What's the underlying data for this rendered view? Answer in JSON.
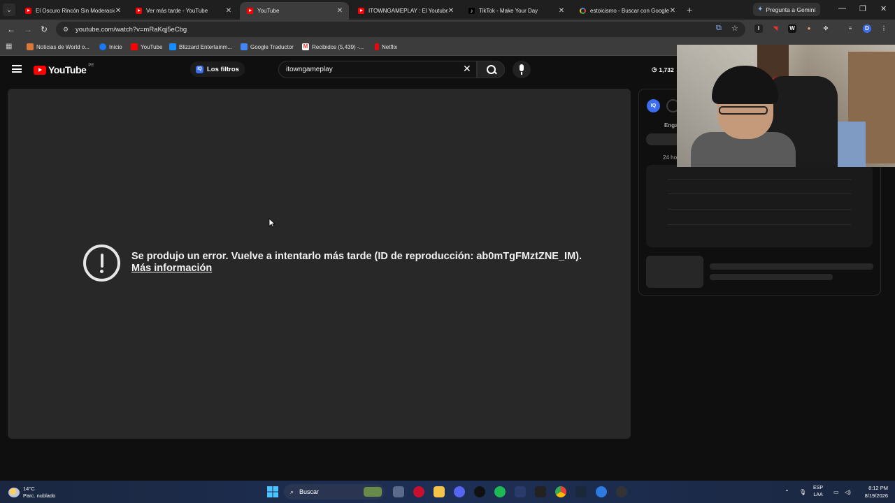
{
  "browser": {
    "tabs": [
      {
        "title": "El Oscuro Rincón Sin Moderación",
        "favicon": "youtube-icon",
        "active": false
      },
      {
        "title": "Ver más tarde - YouTube",
        "favicon": "youtube-icon",
        "active": false
      },
      {
        "title": "YouTube",
        "favicon": "youtube-icon",
        "active": true
      },
      {
        "title": "ITOWNGAMEPLAY : El Youtuber",
        "favicon": "youtube-icon",
        "active": false
      },
      {
        "title": "TikTok - Make Your Day",
        "favicon": "tiktok-icon",
        "active": false
      },
      {
        "title": "estoicismo - Buscar con Google",
        "favicon": "google-icon",
        "active": false
      }
    ],
    "gemini_label": "Pregunta a Gemini",
    "url": "youtube.com/watch?v=mRaKqj5eCbg",
    "bookmarks": [
      {
        "label": "Noticias de World o...",
        "icon": "news-icon"
      },
      {
        "label": "Inicio",
        "icon": "facebook-icon"
      },
      {
        "label": "YouTube",
        "icon": "youtube-icon"
      },
      {
        "label": "Blizzard Entertainm...",
        "icon": "blizzard-icon"
      },
      {
        "label": "Google Traductor",
        "icon": "translate-icon"
      },
      {
        "label": "Recibidos (5,439) -...",
        "icon": "gmail-icon"
      },
      {
        "label": "Netflix",
        "icon": "netflix-icon"
      }
    ]
  },
  "youtube": {
    "logo_text": "YouTube",
    "region": "PE",
    "filters_label": "Los filtros",
    "search_value": "itowngameplay",
    "counter": "1,732",
    "error_message": "Se produjo un error. Vuelve a intentarlo más tarde (ID de reproducción: ab0mTgFMztZNE_IM).",
    "error_link": "Más información",
    "side": {
      "iq_badge": "IQ",
      "label": "Enga",
      "time_label": "24 ho"
    }
  },
  "taskbar": {
    "temperature": "14°C",
    "weather": "Parc. nublado",
    "search_label": "Buscar",
    "lang_top": "ESP",
    "lang_bottom": "LAA",
    "time": "8:12 PM",
    "date": "8/19/2026"
  },
  "colors": {
    "youtube_red": "#ff0000",
    "page_bg": "#0f0f0f",
    "player_bg": "#282828",
    "iq_blue": "#3c6cf0"
  }
}
